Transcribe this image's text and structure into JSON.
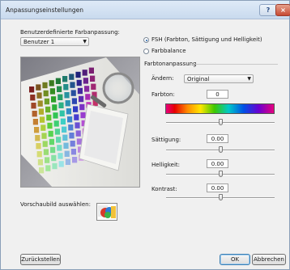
{
  "window": {
    "title": "Anpassungseinstellungen",
    "help_label": "?",
    "close_label": "×"
  },
  "left": {
    "custom_label": "Benutzerdefinierte Farbanpassung:",
    "user_select_value": "Benutzer 1",
    "preview_image_label": "Vorschaubild auswählen:"
  },
  "right": {
    "options": [
      {
        "label": "FSH (Farbton, Sättigung und Helligkeit)",
        "selected": true
      },
      {
        "label": "Farbbalance",
        "selected": false
      }
    ],
    "group_title": "Farbtonanpassung",
    "change_label": "Ändern:",
    "change_value": "Original",
    "hue_label": "Farbton:",
    "hue_value": "0",
    "hue_slider_level": 0.5,
    "saturation_label": "Sättigung:",
    "saturation_value": "0.00",
    "saturation_slider_level": 0.5,
    "brightness_label": "Helligkeit:",
    "brightness_value": "0.00",
    "brightness_slider_level": 0.5,
    "contrast_label": "Kontrast:",
    "contrast_value": "0.00",
    "contrast_slider_level": 0.5
  },
  "footer": {
    "reset_label": "Zurückstellen",
    "ok_label": "OK",
    "cancel_label": "Abbrechen"
  },
  "colors": {
    "accent": "#1f5fa8",
    "titlebar": "#c9daee",
    "close": "#c74a32"
  }
}
